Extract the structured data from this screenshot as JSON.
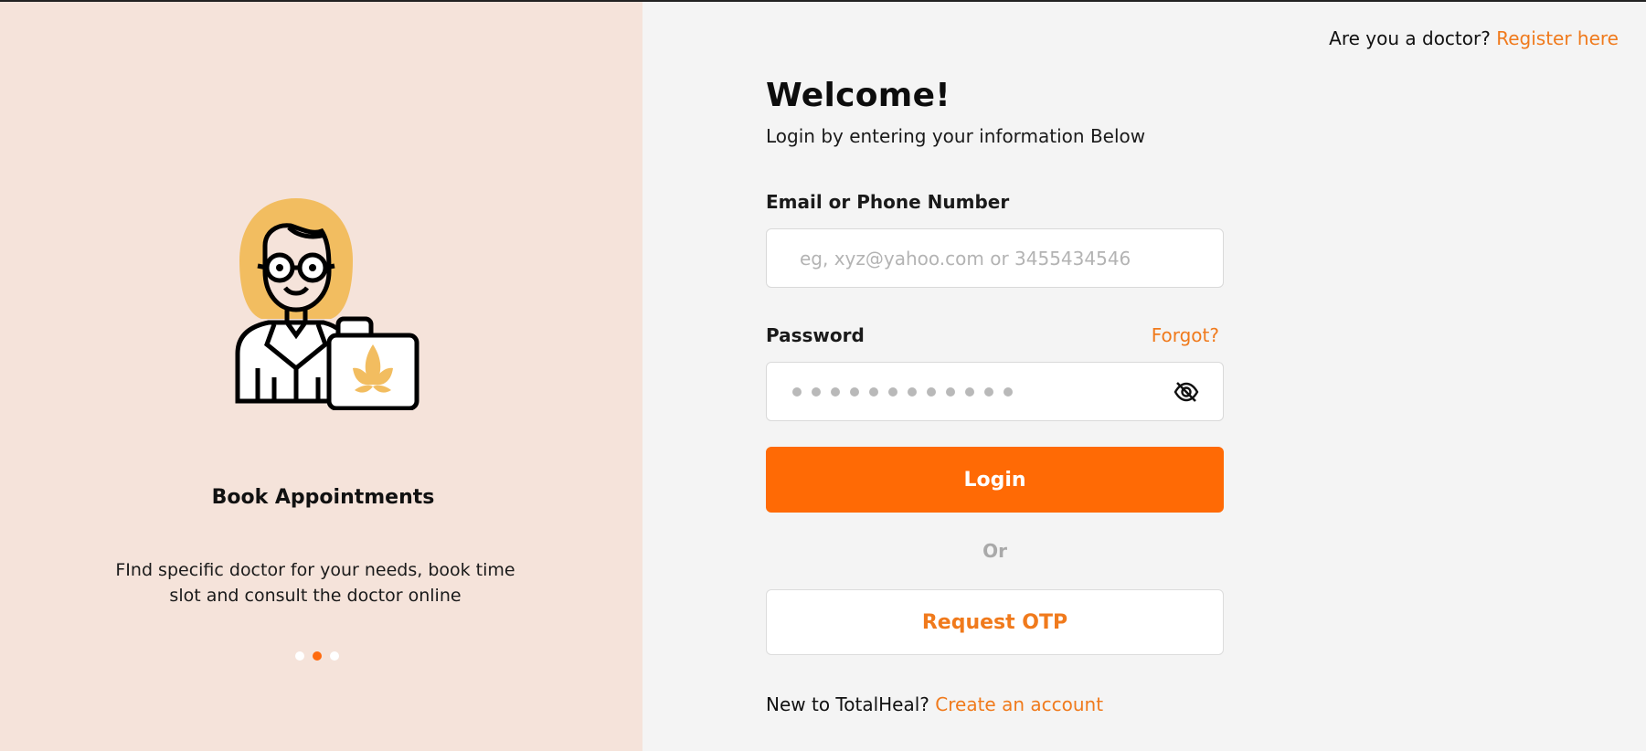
{
  "colors": {
    "left_panel_bg": "#f5e3da",
    "right_panel_bg": "#f4f4f4",
    "accent": "#ff6a05",
    "link": "#f07a1c"
  },
  "onboarding": {
    "illustration_icon": "doctor-with-medical-bag-icon",
    "title": "Book Appointments",
    "description": "FInd specific doctor for your needs, book time slot and consult the doctor online",
    "slides_count": 3,
    "active_slide": 2
  },
  "header": {
    "doctor_prompt": "Are you a doctor?",
    "register_link": "Register here"
  },
  "login": {
    "title": "Welcome!",
    "subtitle": "Login by entering your information Below",
    "email_label": "Email or Phone Number",
    "email_placeholder": "eg, xyz@yahoo.com or 3455434546",
    "email_value": "",
    "password_label": "Password",
    "forgot_label": "Forgot?",
    "password_mask_length": 12,
    "toggle_visibility_icon": "eye-slash-icon",
    "login_button": "Login",
    "or_text": "Or",
    "otp_button": "Request OTP",
    "signup_prompt": "New to TotalHeal?",
    "signup_link": "Create an account"
  }
}
